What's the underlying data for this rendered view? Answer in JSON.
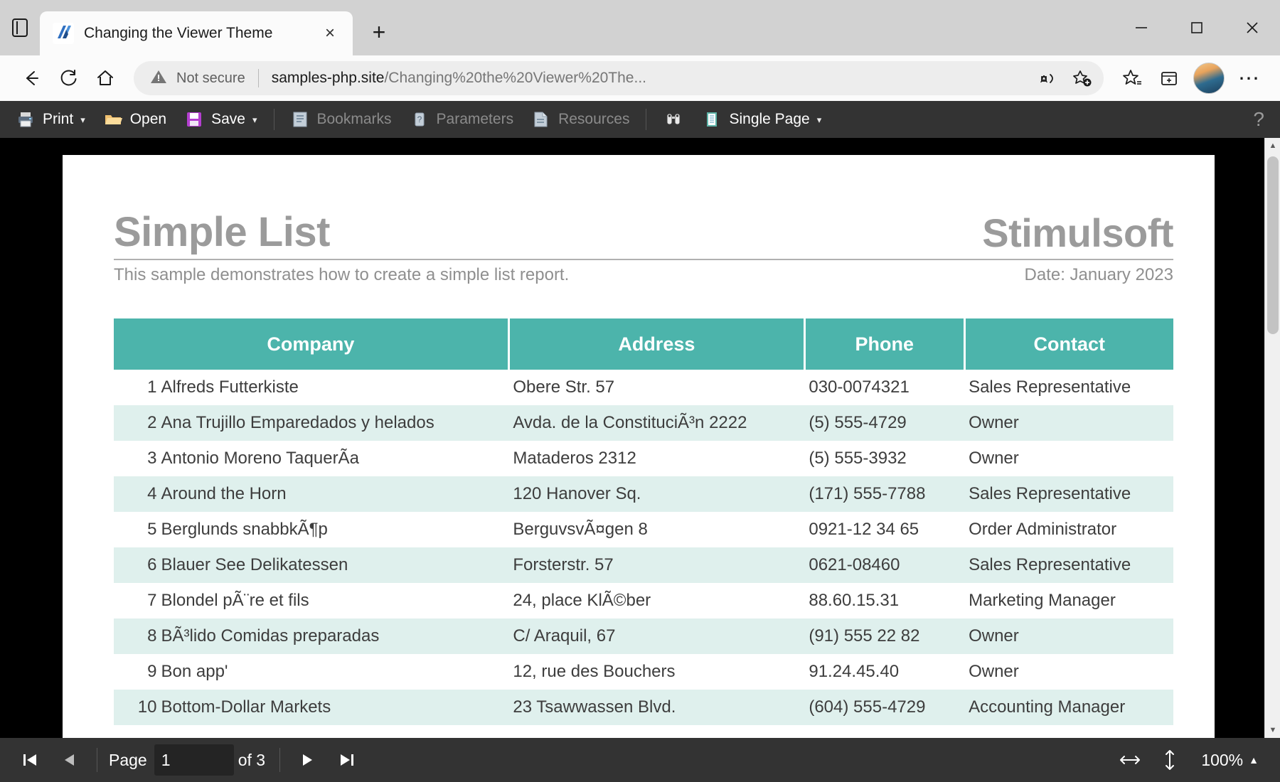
{
  "browser": {
    "tab": {
      "title": "Changing the Viewer Theme",
      "close_label": "×",
      "favicon_name": "stimulsoft-logo-icon"
    },
    "newtab_label": "+",
    "window_controls": {
      "minimize": "minimize-icon",
      "maximize": "maximize-icon",
      "close": "close-icon"
    },
    "nav": {
      "back": "back-arrow-icon",
      "refresh": "refresh-icon",
      "home": "home-icon"
    },
    "omnibox": {
      "security_label": "Not secure",
      "url_bold": "samples-php.site",
      "url_dim": "/Changing%20the%20Viewer%20The...",
      "read_aloud": "read-aloud-icon",
      "add_collection": "add-to-collections-icon"
    },
    "toolbar_right": {
      "favorites": "favorites-icon",
      "collections": "collections-icon",
      "profile": "profile-avatar",
      "settings_more": "⋯"
    }
  },
  "viewer_toolbar": {
    "items": [
      {
        "label": "Print",
        "icon": "printer-icon",
        "has_caret": true,
        "disabled": false
      },
      {
        "label": "Open",
        "icon": "folder-icon",
        "has_caret": false,
        "disabled": false
      },
      {
        "label": "Save",
        "icon": "save-disk-icon",
        "has_caret": true,
        "disabled": false
      },
      {
        "label": "Bookmarks",
        "icon": "bookmarks-icon",
        "has_caret": false,
        "disabled": true
      },
      {
        "label": "Parameters",
        "icon": "parameters-icon",
        "has_caret": false,
        "disabled": true
      },
      {
        "label": "Resources",
        "icon": "resources-icon",
        "has_caret": false,
        "disabled": true
      },
      {
        "label": "",
        "icon": "find-icon",
        "has_caret": false,
        "disabled": false
      },
      {
        "label": "Single Page",
        "icon": "single-page-icon",
        "has_caret": true,
        "disabled": false
      }
    ],
    "help_label": "?"
  },
  "report": {
    "title": "Simple List",
    "brand": "Stimulsoft",
    "subtitle": "This sample demonstrates how to create a simple list report.",
    "date": "Date: January 2023",
    "columns": [
      "Company",
      "Address",
      "Phone",
      "Contact"
    ],
    "rows": [
      {
        "n": "1",
        "company": "Alfreds Futterkiste",
        "address": "Obere Str. 57",
        "phone": "030-0074321",
        "contact": "Sales Representative"
      },
      {
        "n": "2",
        "company": "Ana Trujillo Emparedados y helados",
        "address": "Avda. de la ConstituciÃ³n 2222",
        "phone": "(5) 555-4729",
        "contact": "Owner"
      },
      {
        "n": "3",
        "company": "Antonio Moreno TaquerÃa",
        "address": "Mataderos 2312",
        "phone": "(5) 555-3932",
        "contact": "Owner"
      },
      {
        "n": "4",
        "company": "Around the Horn",
        "address": "120 Hanover Sq.",
        "phone": "(171) 555-7788",
        "contact": "Sales Representative"
      },
      {
        "n": "5",
        "company": "Berglunds snabbkÃ¶p",
        "address": "BerguvsvÃ¤gen 8",
        "phone": "0921-12 34 65",
        "contact": "Order Administrator"
      },
      {
        "n": "6",
        "company": "Blauer See Delikatessen",
        "address": "Forsterstr. 57",
        "phone": "0621-08460",
        "contact": "Sales Representative"
      },
      {
        "n": "7",
        "company": "Blondel pÃ¨re et fils",
        "address": "24, place KlÃ©ber",
        "phone": "88.60.15.31",
        "contact": "Marketing Manager"
      },
      {
        "n": "8",
        "company": "BÃ³lido Comidas preparadas",
        "address": "C/ Araquil, 67",
        "phone": "(91) 555 22 82",
        "contact": "Owner"
      },
      {
        "n": "9",
        "company": "Bon app'",
        "address": "12, rue des Bouchers",
        "phone": "91.24.45.40",
        "contact": "Owner"
      },
      {
        "n": "10",
        "company": "Bottom-Dollar Markets",
        "address": "23 Tsawwassen Blvd.",
        "phone": "(604) 555-4729",
        "contact": "Accounting Manager"
      }
    ]
  },
  "statusbar": {
    "first_page": "first-page-icon",
    "prev_page": "previous-page-icon",
    "page_label": "Page",
    "page_value": "1",
    "of_label": "of 3",
    "next_page": "next-page-icon",
    "last_page": "last-page-icon",
    "fit_width": "fit-width-icon",
    "fit_height": "fit-height-icon",
    "zoom_value": "100%",
    "zoom_caret": "▲"
  },
  "colors": {
    "table_header": "#4cb4ab",
    "table_alt_row": "#dff0ed",
    "toolbar_bg": "#333333",
    "viewer_bg": "#000000",
    "report_gray": "#9b9b9b"
  }
}
